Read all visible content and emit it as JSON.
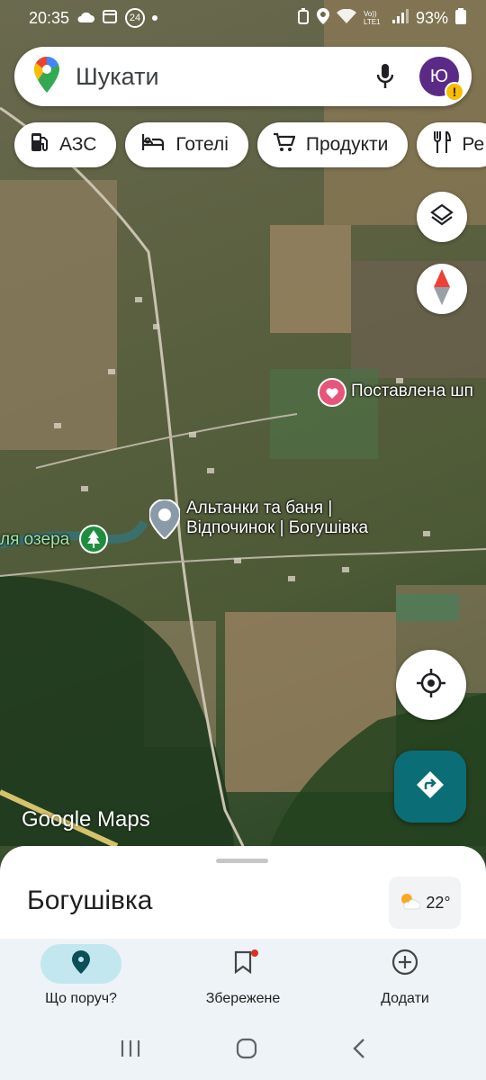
{
  "status": {
    "time": "20:35",
    "notif_count": "24",
    "battery": "93%",
    "network": "Vo)) LTE1"
  },
  "search": {
    "placeholder": "Шукати",
    "avatar_letter": "Ю"
  },
  "chips": [
    {
      "label": "АЗС",
      "icon": "gas-station-icon"
    },
    {
      "label": "Готелі",
      "icon": "hotel-icon"
    },
    {
      "label": "Продукти",
      "icon": "cart-icon"
    },
    {
      "label": "Ре",
      "icon": "restaurant-icon"
    }
  ],
  "map": {
    "places": {
      "saved": "Поставлена шп",
      "main_line1": "Альтанки та баня |",
      "main_line2": "Відпочинок | Богушівка",
      "lake": "ля озера"
    },
    "logo": "Google Maps"
  },
  "sheet": {
    "title": "Богушівка",
    "temperature": "22°"
  },
  "nav": {
    "nearby": "Що поруч?",
    "saved": "Збережене",
    "add": "Додати"
  },
  "colors": {
    "accent_teal": "#0b6e77",
    "active_pill": "#c2e7ef",
    "saved_pin": "#e8547a"
  }
}
